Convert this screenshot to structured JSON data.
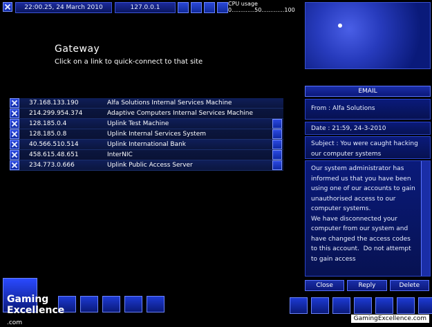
{
  "top_bar": {
    "datetime": "22:00.25, 24 March 2010",
    "ip": "127.0.0.1",
    "cpu_label": "CPU usage",
    "cpu_scale": "0.............50.............100"
  },
  "gateway": {
    "title": "Gateway",
    "subtitle": "Click on a link to quick-connect to that site",
    "links": [
      {
        "ip": "37.168.133.190",
        "name": "Alfa Solutions Internal Services Machine"
      },
      {
        "ip": "214.299.954.374",
        "name": "Adaptive Computers Internal Services Machine"
      },
      {
        "ip": "128.185.0.4",
        "name": "Uplink Test Machine"
      },
      {
        "ip": "128.185.0.8",
        "name": "Uplink Internal Services System"
      },
      {
        "ip": "40.566.510.514",
        "name": "Uplink International Bank"
      },
      {
        "ip": "458.615.48.651",
        "name": "InterNIC"
      },
      {
        "ip": "234.773.0.666",
        "name": "Uplink Public Access Server"
      }
    ]
  },
  "email": {
    "header": "EMAIL",
    "from": "From : Alfa Solutions",
    "date": "Date : 21:59, 24-3-2010",
    "subject": "Subject : You were caught hacking our computer systems",
    "body": "Our system administrator has informed us that you have been using one of our accounts to gain unauthorised access to our computer systems.\nWe have disconnected your computer from our system and have changed the access codes to this account.  Do not attempt to gain access",
    "buttons": {
      "close": "Close",
      "reply": "Reply",
      "delete": "Delete"
    }
  },
  "branding": {
    "logo_line1": "Gaming",
    "logo_line2": "Excellence",
    "logo_line3": ".com",
    "watermark": "GamingExcellence.com"
  },
  "colors": {
    "accent": "#2b49e2",
    "panel": "#0a1a7a",
    "background": "#000000"
  }
}
